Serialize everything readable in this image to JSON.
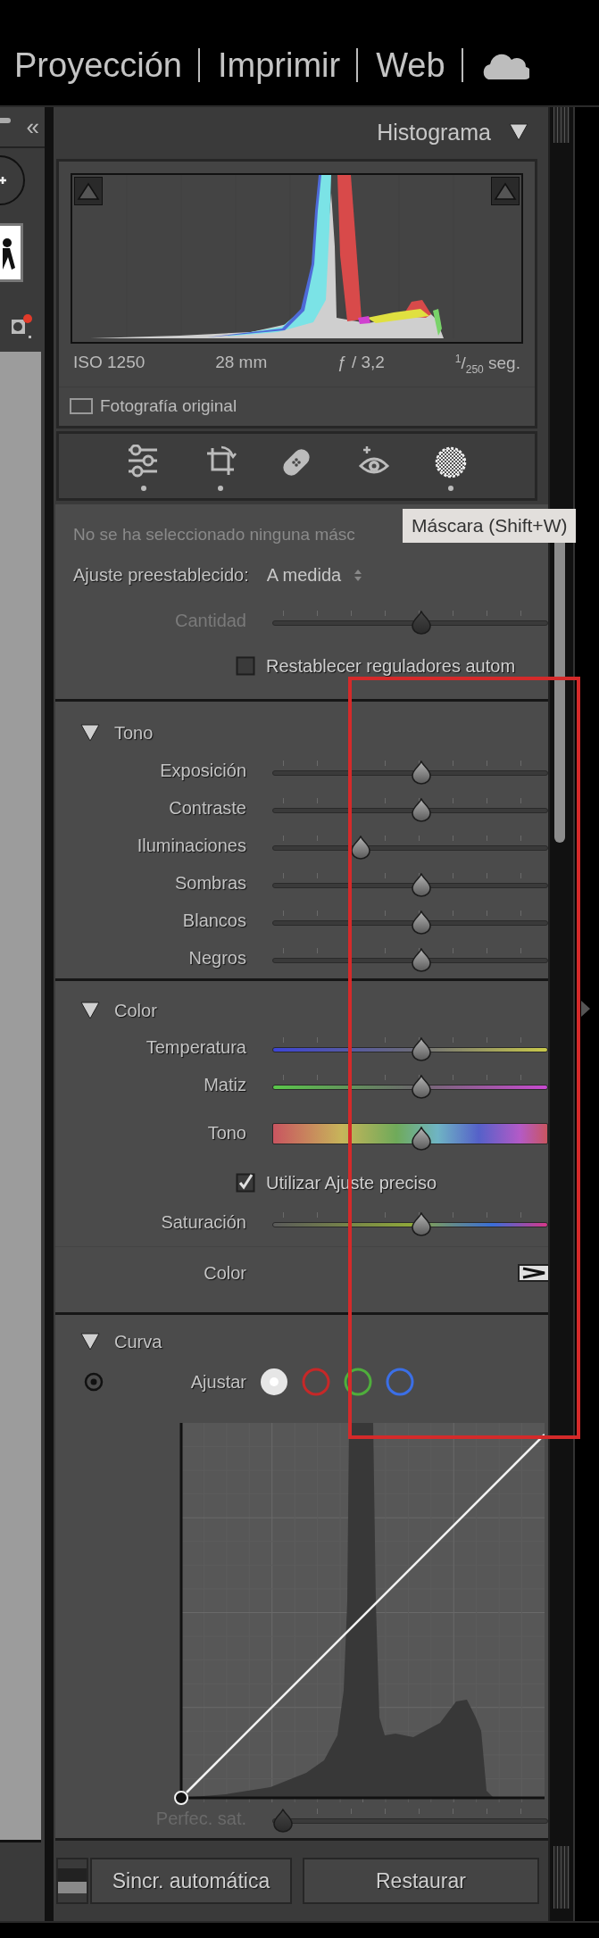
{
  "nav": {
    "items": [
      {
        "label": "Proyección"
      },
      {
        "label": "Imprimir"
      },
      {
        "label": "Web"
      }
    ]
  },
  "left_panel": {
    "collapse_glyph": "«"
  },
  "histogram": {
    "title": "Histograma",
    "expanded": true,
    "info": [
      "ISO 1250",
      "28 mm",
      "ƒ / 3,2",
      "$^{1}$/$_{250}$ seg."
    ],
    "original_photo": {
      "label": "Fotografía original",
      "checked": false
    }
  },
  "tools": [
    {
      "kind": "sliders",
      "active": true
    },
    {
      "kind": "crop",
      "active": true
    },
    {
      "kind": "heal",
      "active": false
    },
    {
      "kind": "redeye",
      "active": false
    },
    {
      "kind": "mask",
      "active": true
    }
  ],
  "tooltip": "Máscara (Shift+W)",
  "mask": {
    "message": "No se ha seleccionado ninguna másc",
    "preset_label": "Ajuste preestablecido:",
    "preset_value": "A medida",
    "amount": {
      "label": "Cantidad",
      "level": 0.54,
      "disabled": true
    },
    "reset": {
      "label": "Restablecer reguladores autom",
      "checked": false
    }
  },
  "tone": {
    "title": "Tono",
    "expanded": true,
    "sliders": [
      {
        "label": "Exposición",
        "level": 0.54
      },
      {
        "label": "Contraste",
        "level": 0.54
      },
      {
        "label": "Iluminaciones",
        "level": 0.32
      },
      {
        "label": "Sombras",
        "level": 0.54
      },
      {
        "label": "Blancos",
        "level": 0.54
      },
      {
        "label": "Negros",
        "level": 0.54
      }
    ]
  },
  "color": {
    "title": "Color",
    "expanded": true,
    "controls": [
      {
        "kind": "temperature",
        "label": "Temperatura",
        "level": 0.54
      },
      {
        "kind": "tint",
        "label": "Matiz",
        "level": 0.54
      },
      {
        "kind": "hue",
        "label": "Tono",
        "level": 0.54
      },
      {
        "kind": "checkbox",
        "label": "Utilizar Ajuste preciso",
        "checked": true
      },
      {
        "kind": "saturation",
        "label": "Saturación",
        "level": 0.54
      }
    ],
    "color_row": {
      "label": "Color"
    }
  },
  "curve": {
    "title": "Curva",
    "expanded": true,
    "adjust_label": "Ajustar",
    "channels": [
      {
        "color": "#e6e6e6",
        "selected": true
      },
      {
        "color": "#c62828",
        "selected": false
      },
      {
        "color": "#4fae3c",
        "selected": false
      },
      {
        "color": "#3b6fe6",
        "selected": false
      }
    ],
    "saturation": {
      "label": "Perfec. sat.",
      "level": 0.04
    }
  },
  "buttons": {
    "auto_sync": {
      "label": "Sincr. automática",
      "on": false
    },
    "reset": "Restaurar"
  },
  "annotation": {
    "kind": "frame"
  }
}
